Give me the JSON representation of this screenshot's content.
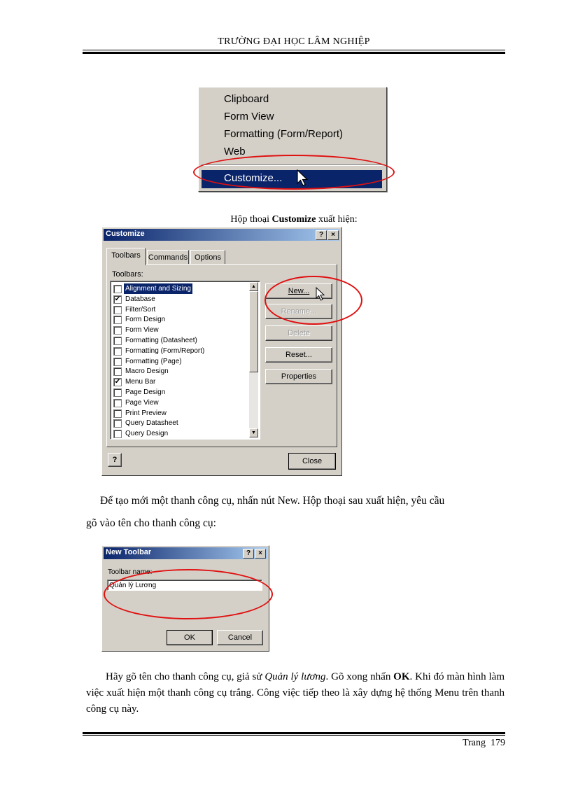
{
  "header": {
    "title": "TRƯỜNG ĐẠI HỌC LÂM NGHIỆP"
  },
  "context_menu": {
    "items": [
      "Clipboard",
      "Form View",
      "Formatting (Form/Report)",
      "Web"
    ],
    "selected": "Customize..."
  },
  "caption1": {
    "before": "Hộp thoại ",
    "bold": "Customize",
    "after": " xuất hiện:"
  },
  "customize_dialog": {
    "title": "Customize",
    "help_btn": "?",
    "close_btn": "×",
    "tabs": [
      "Toolbars",
      "Commands",
      "Options"
    ],
    "list_label": "Toolbars:",
    "toolbars": [
      {
        "label": "Alignment and Sizing",
        "checked": false,
        "selected": true
      },
      {
        "label": "Database",
        "checked": true
      },
      {
        "label": "Filter/Sort",
        "checked": false
      },
      {
        "label": "Form Design",
        "checked": false
      },
      {
        "label": "Form View",
        "checked": false
      },
      {
        "label": "Formatting (Datasheet)",
        "checked": false
      },
      {
        "label": "Formatting (Form/Report)",
        "checked": false
      },
      {
        "label": "Formatting (Page)",
        "checked": false
      },
      {
        "label": "Macro Design",
        "checked": false
      },
      {
        "label": "Menu Bar",
        "checked": true
      },
      {
        "label": "Page Design",
        "checked": false
      },
      {
        "label": "Page View",
        "checked": false
      },
      {
        "label": "Print Preview",
        "checked": false
      },
      {
        "label": "Query Datasheet",
        "checked": false
      },
      {
        "label": "Query Design",
        "checked": false
      }
    ],
    "buttons": {
      "new": "New...",
      "rename": "Rename...",
      "delete": "Delete",
      "reset": "Reset...",
      "properties": "Properties",
      "close": "Close",
      "help_icon": "?"
    }
  },
  "paragraph1": {
    "line1": "Để tạo mới một thanh công cụ, nhấn nút New. Hộp thoại sau xuất hiện, yêu cầu",
    "line2": "gõ vào tên cho thanh công cụ:"
  },
  "new_toolbar_dialog": {
    "title": "New Toolbar",
    "help_btn": "?",
    "close_btn": "×",
    "field_label": "Toolbar name:",
    "field_value": "Quản lý Lương",
    "ok": "OK",
    "cancel": "Cancel"
  },
  "paragraph2": {
    "p1": "Hãy gõ tên cho thanh công cụ, giả sử ",
    "italic": "Quản lý lương",
    "p2": ". Gõ xong nhấn ",
    "bold": "OK",
    "p3": ". Khi đó màn hình làm việc xuất hiện một thanh công cụ trắng. Công việc tiếp theo là xây dựng hệ thống Menu trên thanh công cụ này."
  },
  "footer": {
    "label": "Trang",
    "page_number": "179"
  },
  "colors": {
    "selection": "#0a246a",
    "dialog_face": "#d4d0c8",
    "highlight_ring": "#e01010"
  }
}
